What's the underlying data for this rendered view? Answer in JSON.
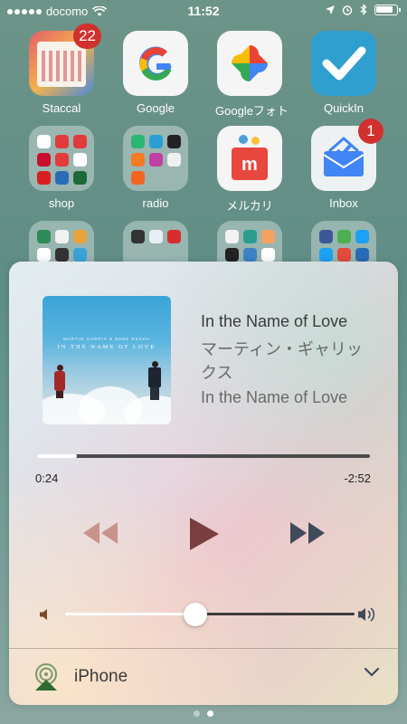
{
  "status_bar": {
    "carrier": "docomo",
    "time": "11:52"
  },
  "apps": [
    {
      "label": "Staccal",
      "badge": "22"
    },
    {
      "label": "Google"
    },
    {
      "label": "Googleフォト"
    },
    {
      "label": "QuickIn"
    },
    {
      "label": "shop"
    },
    {
      "label": "radio"
    },
    {
      "label": "メルカリ"
    },
    {
      "label": "Inbox",
      "badge": "1"
    }
  ],
  "now_playing": {
    "title": "In the Name of Love",
    "artist": "マーティン・ギャリックス",
    "album": "In the Name of Love",
    "artwork_title": "IN THE NAME OF LOVE",
    "artwork_artist": "MARTIN GARRIX & BEBE REXHA",
    "elapsed": "0:24",
    "remaining": "-2:52",
    "progress_fraction": 0.12,
    "volume_fraction": 0.45
  },
  "airplay": {
    "device": "iPhone"
  },
  "page_indicator": {
    "count": 2,
    "active_index": 1
  },
  "colors": {
    "rewind": "#c9938c",
    "play": "#7a3e3e",
    "forward": "#3f4a5a",
    "badge": "#d0312d",
    "airplay_green": "#2f6b2f"
  }
}
